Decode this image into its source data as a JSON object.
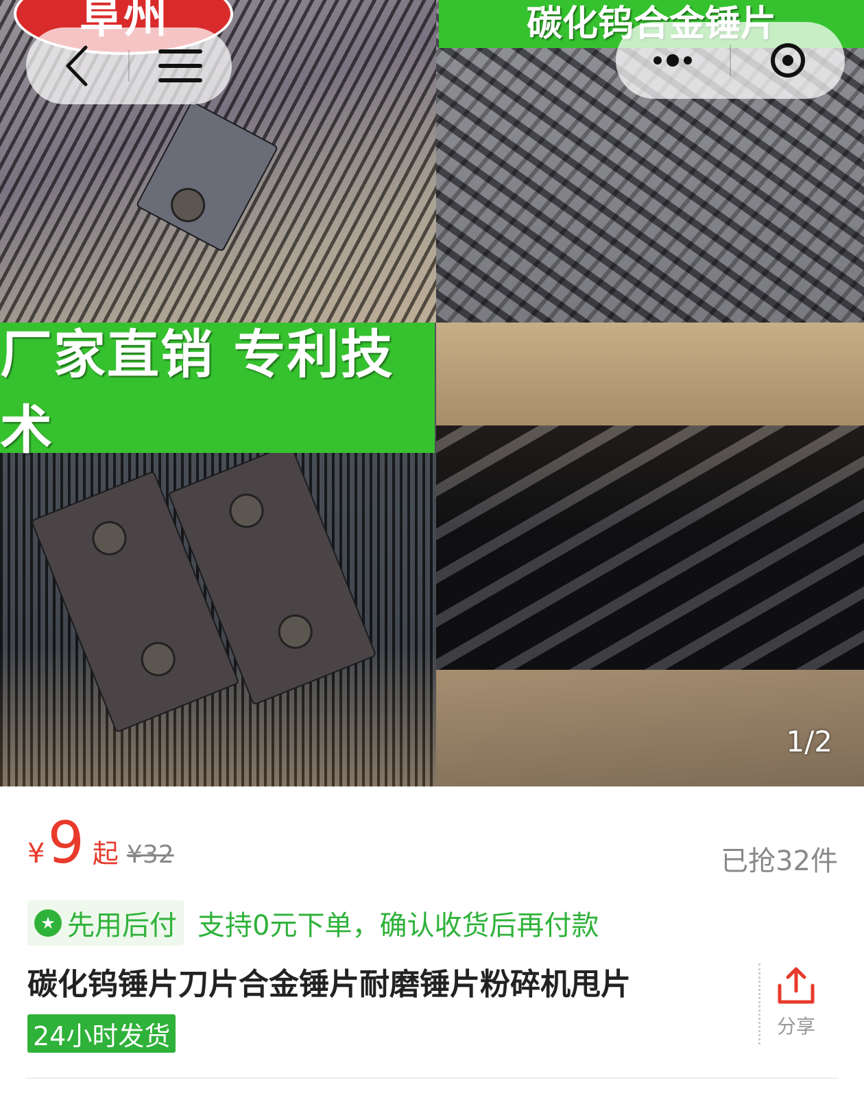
{
  "gallery": {
    "logo_text": "阜州",
    "banner_top": "碳化钨合金锤片",
    "banner_mid": "厂家直销  专利技术",
    "counter": "1/2"
  },
  "nav": {
    "back_icon": "chevron-left-icon",
    "menu_icon": "hamburger-menu-icon",
    "more_icon": "more-dots-icon",
    "close_icon": "target-close-icon"
  },
  "price": {
    "currency": "¥",
    "value": "9",
    "suffix": "起",
    "original": "¥32",
    "sold": "已抢32件",
    "color": "#e83a2b"
  },
  "payment": {
    "badge_label": "先用后付",
    "description": "支持0元下单，确认收货后再付款",
    "color": "#2fb23a"
  },
  "product": {
    "title": "碳化钨锤片刀片合金锤片耐磨锤片粉碎机甩片",
    "ship_tag": "24小时发货"
  },
  "share": {
    "label": "分享",
    "icon": "share-upload-icon",
    "color": "#e83a2b"
  }
}
